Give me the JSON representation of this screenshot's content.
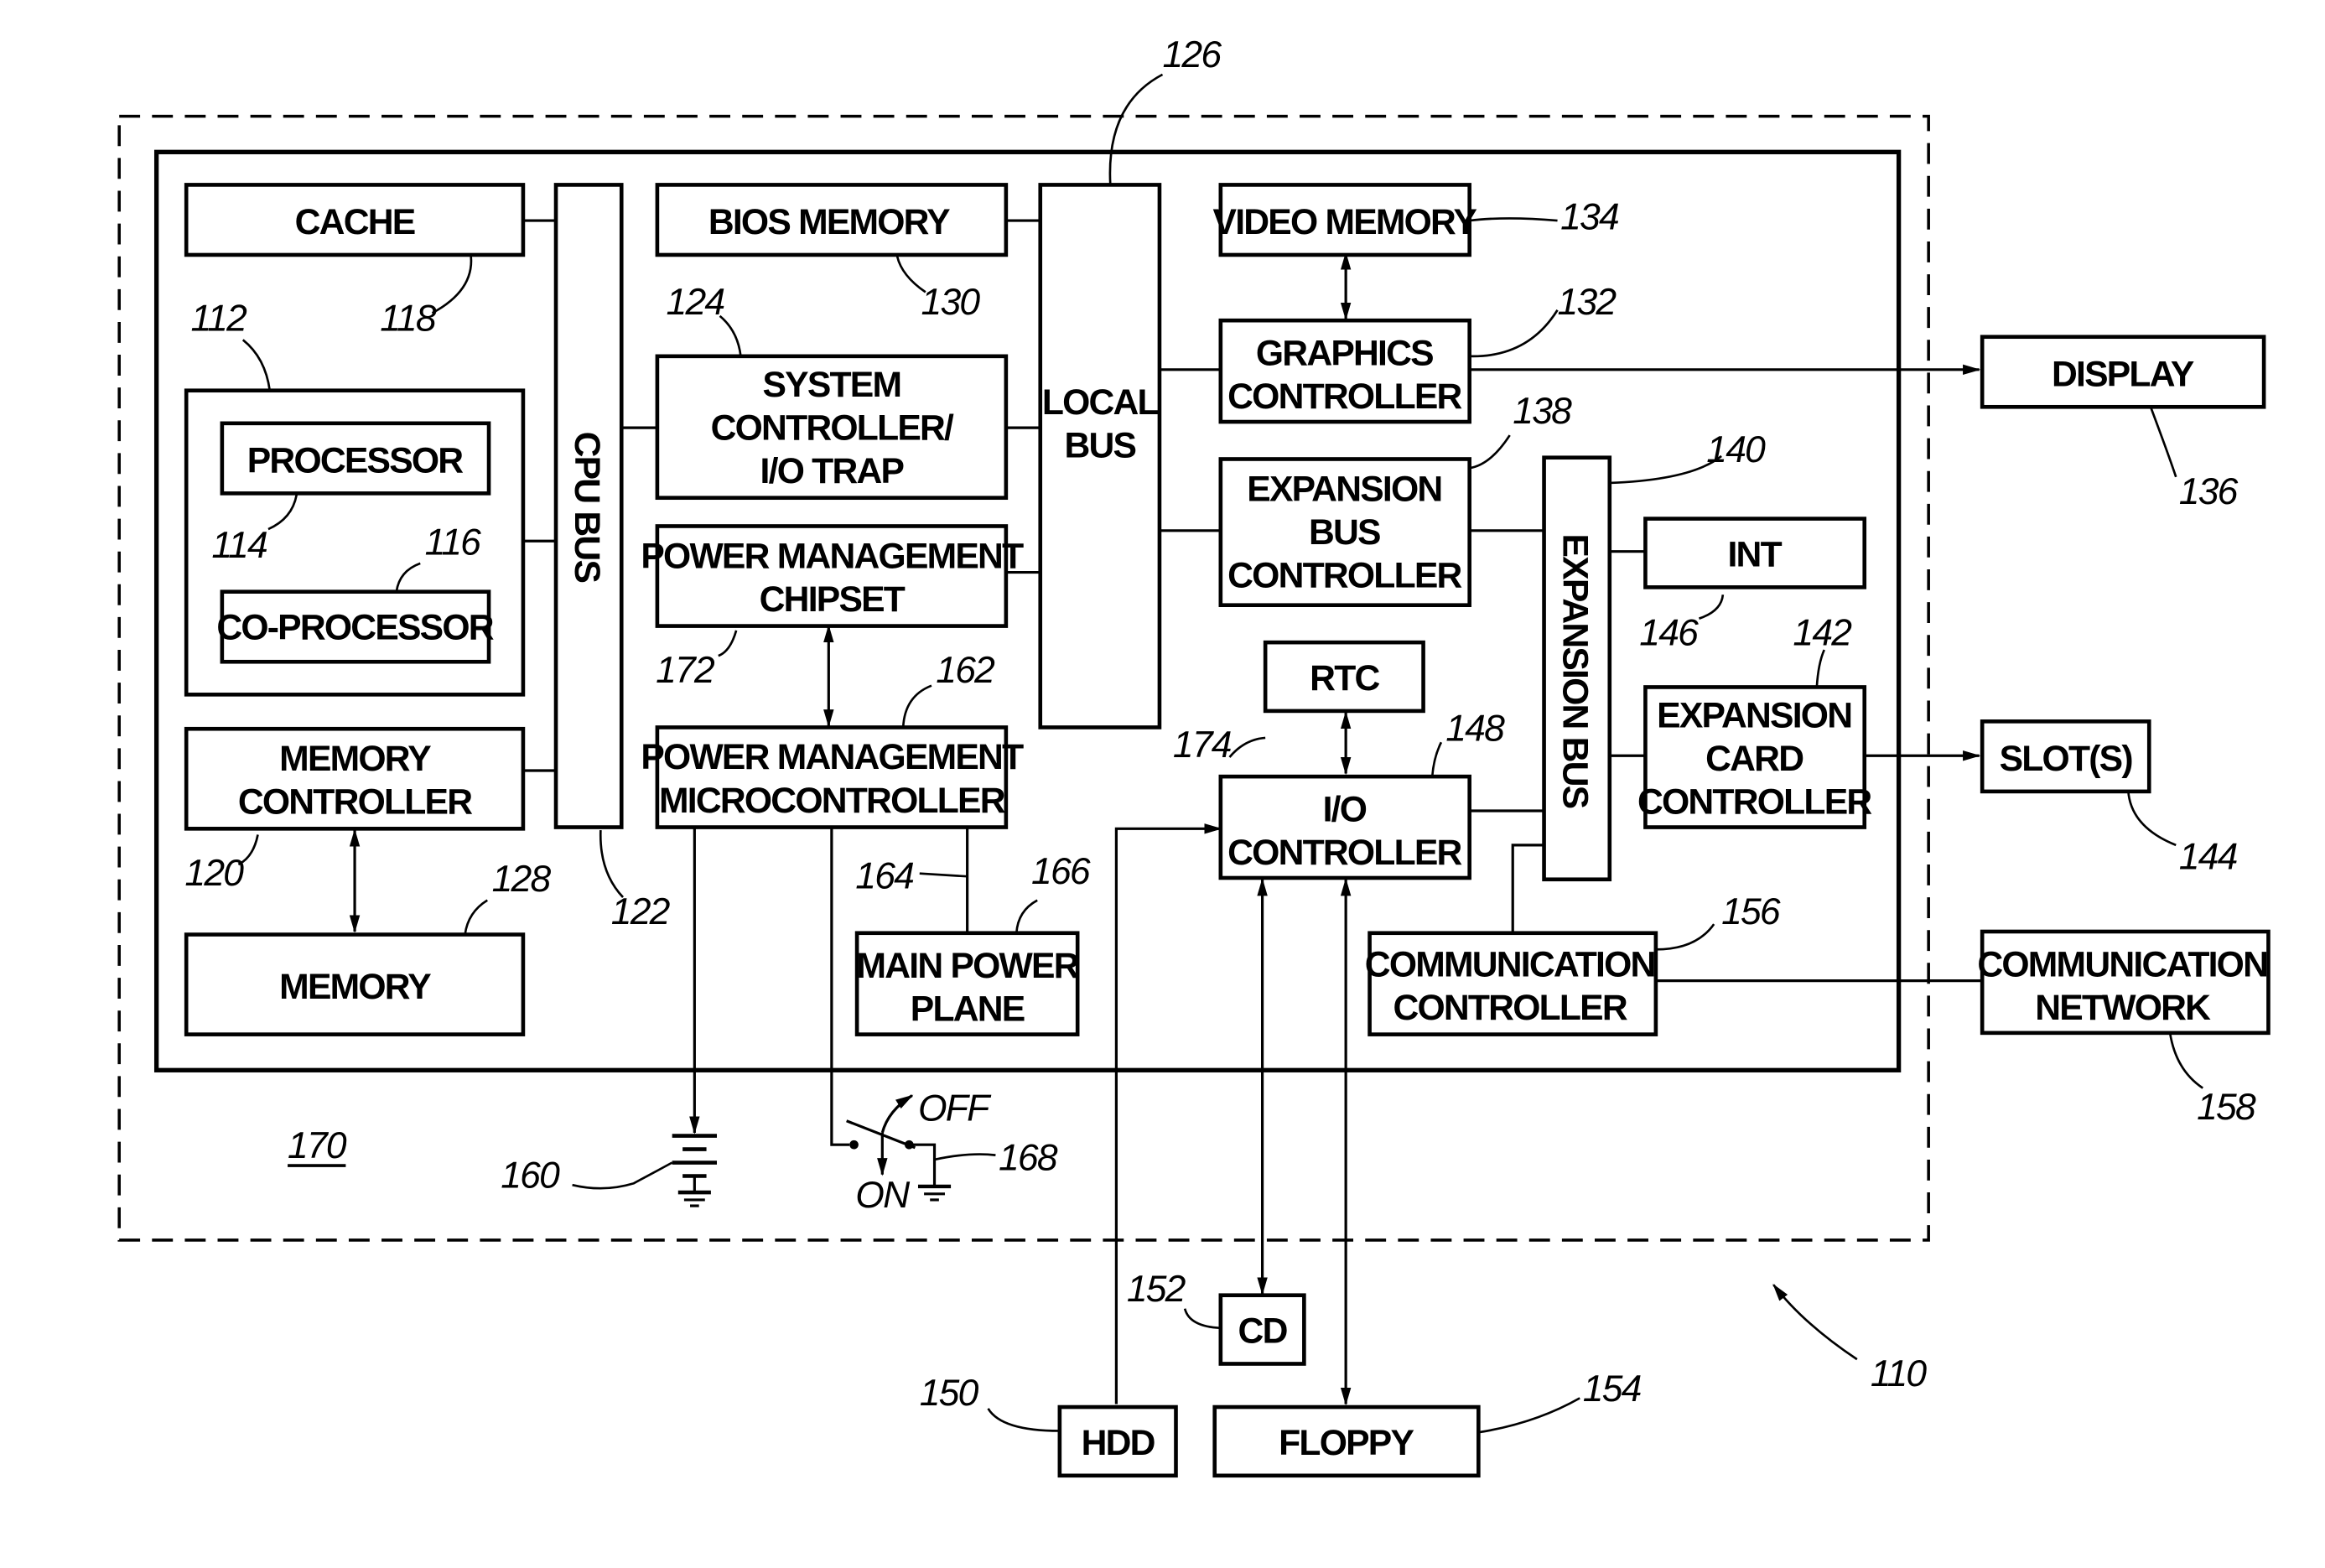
{
  "diagram": {
    "figure_ref": "110",
    "enclosure_ref": "170",
    "blocks": {
      "cache": {
        "lines": [
          "CACHE"
        ],
        "ref": "118"
      },
      "processor_group": {
        "ref": "112"
      },
      "processor": {
        "lines": [
          "PROCESSOR"
        ],
        "ref": "114"
      },
      "coprocessor": {
        "lines": [
          "CO-PROCESSOR"
        ],
        "ref": "116"
      },
      "memory_controller": {
        "lines": [
          "MEMORY",
          "CONTROLLER"
        ],
        "ref": "120"
      },
      "memory": {
        "lines": [
          "MEMORY"
        ],
        "ref": "128"
      },
      "cpu_bus": {
        "lines": [
          "CPU BUS"
        ],
        "ref": "122"
      },
      "bios_memory": {
        "lines": [
          "BIOS MEMORY"
        ],
        "ref": "130"
      },
      "system_controller": {
        "lines": [
          "SYSTEM",
          "CONTROLLER/",
          "I/O TRAP"
        ],
        "ref": "124"
      },
      "pm_chipset": {
        "lines": [
          "POWER MANAGEMENT",
          "CHIPSET"
        ],
        "ref": "172"
      },
      "pm_microcontroller": {
        "lines": [
          "POWER MANAGEMENT",
          "MICROCONTROLLER"
        ],
        "ref": "162"
      },
      "main_power_plane": {
        "lines": [
          "MAIN POWER",
          "PLANE"
        ],
        "ref": "166",
        "link_ref": "164"
      },
      "local_bus": {
        "lines": [
          "LOCAL",
          "BUS"
        ],
        "ref": "126"
      },
      "video_memory": {
        "lines": [
          "VIDEO MEMORY"
        ],
        "ref": "134"
      },
      "graphics_controller": {
        "lines": [
          "GRAPHICS",
          "CONTROLLER"
        ],
        "ref": "132"
      },
      "expansion_bus_controller": {
        "lines": [
          "EXPANSION",
          "BUS",
          "CONTROLLER"
        ],
        "ref": "138"
      },
      "expansion_bus": {
        "lines": [
          "EXPANSION BUS"
        ],
        "ref": "140"
      },
      "int": {
        "lines": [
          "INT"
        ],
        "ref": "146"
      },
      "expansion_card_controller": {
        "lines": [
          "EXPANSION",
          "CARD",
          "CONTROLLER"
        ],
        "ref": "142"
      },
      "rtc": {
        "lines": [
          "RTC"
        ],
        "ref": "174"
      },
      "io_controller": {
        "lines": [
          "I/O",
          "CONTROLLER"
        ],
        "ref": "148"
      },
      "communication_controller": {
        "lines": [
          "COMMUNICATION",
          "CONTROLLER"
        ],
        "ref": "156"
      },
      "display": {
        "lines": [
          "DISPLAY"
        ],
        "ref": "136"
      },
      "slots": {
        "lines": [
          "SLOT(S)"
        ],
        "ref": "144"
      },
      "communication_network": {
        "lines": [
          "COMMUNICATION",
          "NETWORK"
        ],
        "ref": "158"
      },
      "cd": {
        "lines": [
          "CD"
        ],
        "ref": "152"
      },
      "hdd": {
        "lines": [
          "HDD"
        ],
        "ref": "150"
      },
      "floppy": {
        "lines": [
          "FLOPPY"
        ],
        "ref": "154"
      },
      "battery": {
        "ref": "160"
      },
      "power_switch": {
        "ref": "168",
        "off_label": "OFF",
        "on_label": "ON"
      }
    }
  }
}
